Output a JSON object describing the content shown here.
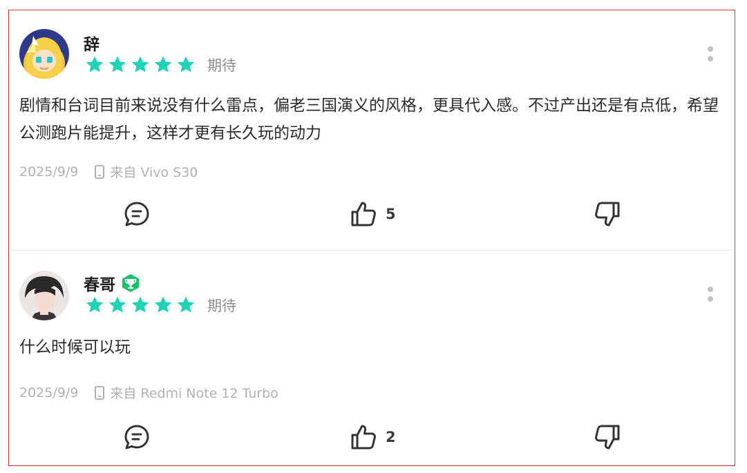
{
  "reviews": [
    {
      "username": "辞",
      "has_badge": false,
      "stars": 5,
      "rating_label": "期待",
      "content": "剧情和台词目前来说没有什么雷点，偏老三国演义的风格，更具代入感。不过产出还是有点低，希望公测跑片能提升，这样才更有长久玩的动力",
      "date": "2025/9/9",
      "device": "来自 Vivo S30",
      "likes": "5"
    },
    {
      "username": "春哥",
      "has_badge": true,
      "stars": 5,
      "rating_label": "期待",
      "content": "什么时候可以玩",
      "date": "2025/9/9",
      "device": "来自 Redmi Note 12 Turbo",
      "likes": "2"
    }
  ],
  "colors": {
    "star": "#1fd3b5",
    "badge": "#19c26e",
    "frame_border": "#d23a3a",
    "meta_text": "#b0b0b0"
  },
  "icons": {
    "reply": "comment-icon",
    "like": "thumbs-up-icon",
    "dislike": "thumbs-down-icon",
    "more": "more-vertical-icon",
    "device": "phone-icon"
  }
}
